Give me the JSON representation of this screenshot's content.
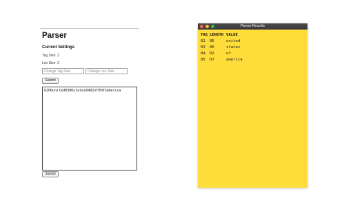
{
  "parser": {
    "title": "Parser",
    "current_settings_heading": "Current Settings",
    "tag_size_text": "Tag Size: 2",
    "len_size_text": "Len Size: 2",
    "tag_size_input": {
      "value": "",
      "placeholder": "Change Tag Size"
    },
    "len_size_input": {
      "value": "",
      "placeholder": "Change Len Size"
    },
    "settings_submit_label": "Submit",
    "input_text": "0206united0306states0402of0507america",
    "parse_submit_label": "Submit"
  },
  "results_window": {
    "title": "Parser Results",
    "columns": [
      "TAG",
      "LENGTH",
      "VALUE"
    ],
    "rows": [
      {
        "tag": "02",
        "length": "06",
        "value": "united"
      },
      {
        "tag": "03",
        "length": "06",
        "value": "states"
      },
      {
        "tag": "04",
        "length": "02",
        "value": "of"
      },
      {
        "tag": "05",
        "length": "07",
        "value": "america"
      }
    ],
    "background_color": "#fedd3a"
  }
}
